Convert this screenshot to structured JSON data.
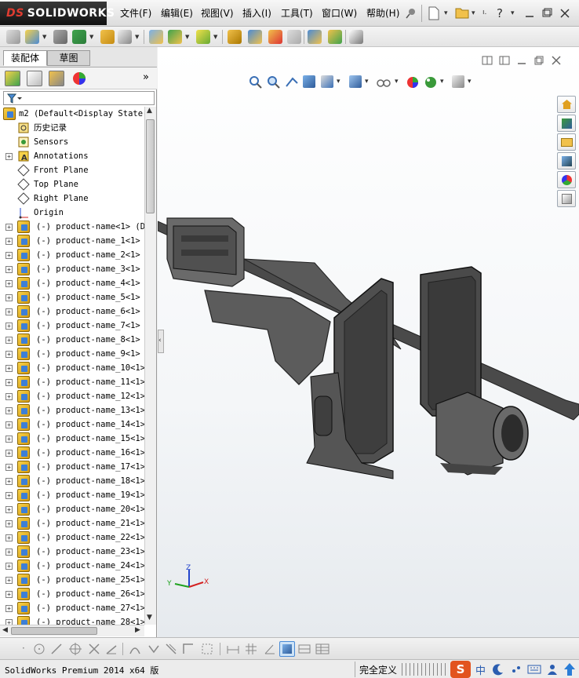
{
  "app": {
    "brand": "SOLIDWORKS",
    "brand_prefix": "DS",
    "menus": [
      "文件(F)",
      "编辑(E)",
      "视图(V)",
      "插入(I)",
      "工具(T)",
      "窗口(W)",
      "帮助(H)"
    ],
    "title_small": "ı."
  },
  "left_panel": {
    "tabs": [
      "装配体",
      "草图"
    ],
    "active_tab": 0,
    "expand_arrow": "»",
    "root_label": "m2  (Default<Display State-",
    "fixed_items": [
      {
        "label": "历史记录",
        "icon": "history-icon",
        "expandable": false
      },
      {
        "label": "Sensors",
        "icon": "sensors-icon",
        "expandable": false
      },
      {
        "label": "Annotations",
        "icon": "annotations-icon",
        "expandable": true
      },
      {
        "label": "Front Plane",
        "icon": "plane-icon",
        "expandable": false
      },
      {
        "label": "Top Plane",
        "icon": "plane-icon",
        "expandable": false
      },
      {
        "label": "Right Plane",
        "icon": "plane-icon",
        "expandable": false
      },
      {
        "label": "Origin",
        "icon": "origin-icon",
        "expandable": false
      }
    ],
    "components": [
      "(-) product-name<1> (De:",
      "(-) product-name_1<1> (",
      "(-) product-name_2<1> (",
      "(-) product-name_3<1> (",
      "(-) product-name_4<1> (",
      "(-) product-name_5<1> (",
      "(-) product-name_6<1> (",
      "(-) product-name_7<1> (",
      "(-) product-name_8<1> (",
      "(-) product-name_9<1> (",
      "(-) product-name_10<1>",
      "(-) product-name_11<1>",
      "(-) product-name_12<1>",
      "(-) product-name_13<1>",
      "(-) product-name_14<1>",
      "(-) product-name_15<1>",
      "(-) product-name_16<1>",
      "(-) product-name_17<1>",
      "(-) product-name_18<1>",
      "(-) product-name_19<1>",
      "(-) product-name_20<1>",
      "(-) product-name_21<1>",
      "(-) product-name_22<1>",
      "(-) product-name_23<1>",
      "(-) product-name_24<1>",
      "(-) product-name_25<1>",
      "(-) product-name_26<1>",
      "(-) product-name_27<1>",
      "(-) product-name_28<1>"
    ]
  },
  "triad": {
    "x": "X",
    "y": "Y",
    "z": "Z"
  },
  "status": {
    "product": "SolidWorks Premium 2014 x64 版",
    "mode": "完全定义",
    "ime_label": "中"
  },
  "colors": {
    "accent_red": "#e03c31",
    "model_gray": "#5a5a5a",
    "axis_x": "#d32020",
    "axis_y": "#1fa21f",
    "axis_z": "#2244cc"
  }
}
